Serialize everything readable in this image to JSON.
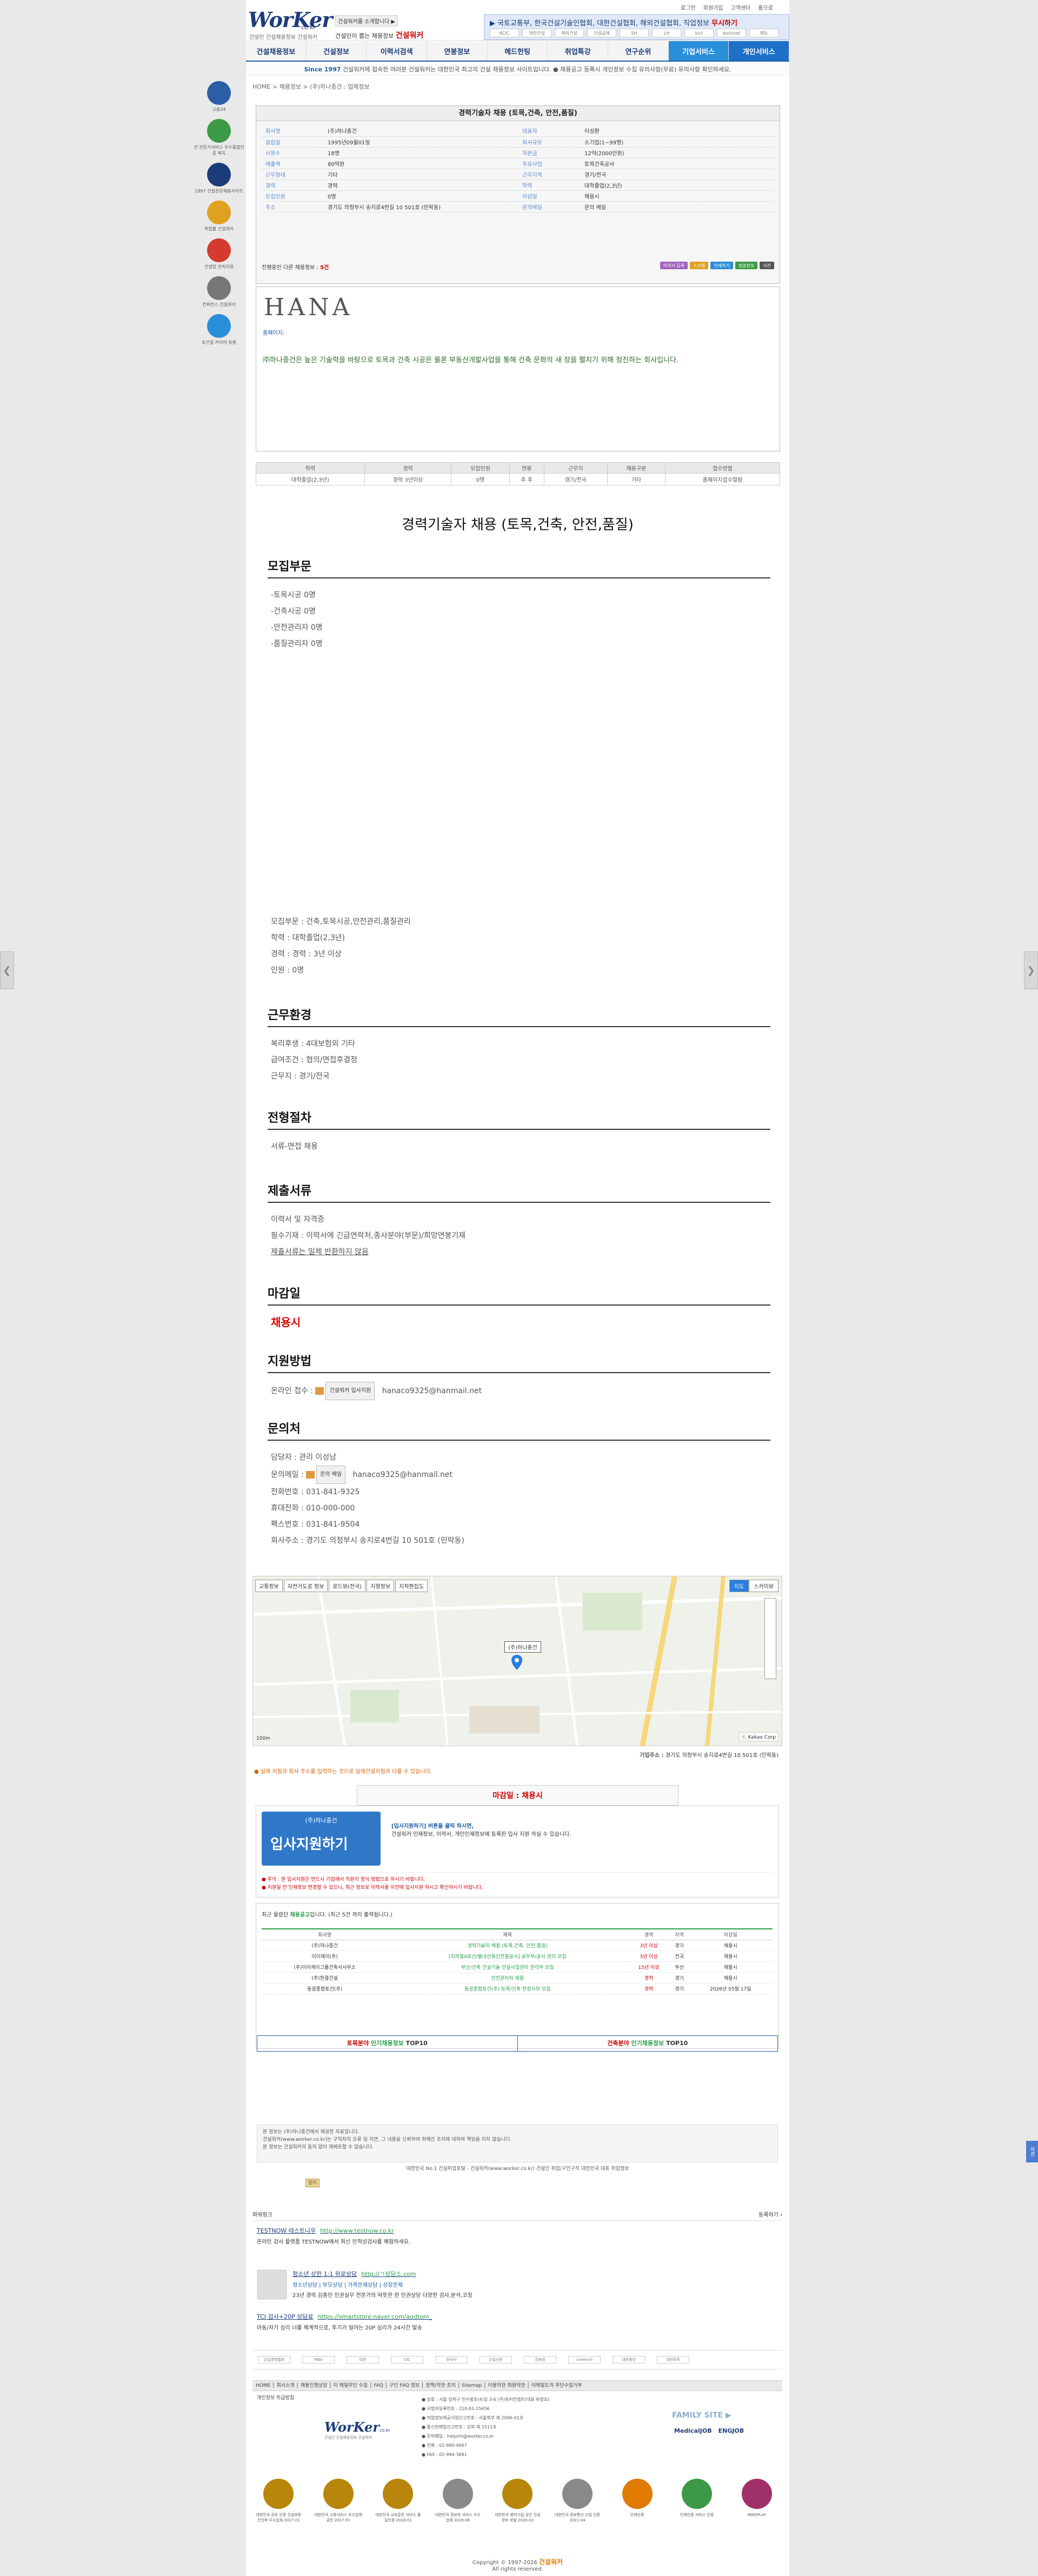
{
  "side": {
    "left_arrow": "❮",
    "right_arrow": "❯",
    "feedback": "의견"
  },
  "header": {
    "logo_text": "WorKer",
    "logo_domain": "co.kr",
    "logo_tagline": "건설인 건설채용정보 건설워커",
    "promo_badge": "건설워커를 소개합니다 ▶",
    "promo_line": "건설인이 뽑는 채용정보",
    "promo_brand": "건설워커",
    "top_links": [
      "로그인",
      "회원가입",
      "고객센터",
      "홈으로"
    ],
    "ticker_label": "▶ 국토교통부, 한국건설기술인협회, 대한건설협회, 해외건설협회, 직업정보 ",
    "ticker_accent": "무시하기",
    "ticker_logos": [
      "KCIC",
      "대한건설",
      "해외건설",
      "건설공제",
      "SH",
      "LH",
      "kict",
      "worknet",
      "에듀"
    ]
  },
  "nav": [
    "건설채용정보",
    "건설정보",
    "이력서검색",
    "연봉정보",
    "헤드헌팅",
    "취업특강",
    "연구순위",
    "기업서비스",
    "개인서비스"
  ],
  "notice": {
    "accent": "Since 1997",
    "text": " 건설워커에 접속한 여러분 건설워커는 대한민국 최고의 건설 채용정보 사이트입니다. ● 채용공고 등록시 개인정보 수집 유의사항(무료) 유의사항 확인하세요."
  },
  "breadcrumb": "HOME > 채용정보 > (주)하나종건 : 업체정보",
  "quick": [
    {
      "label": "고용24",
      "color": "#2b5ea7"
    },
    {
      "label": "건 전문가서비스 우수중합인증 획득",
      "color": "#3c9a46"
    },
    {
      "label": "1997 건설전문채용사이트",
      "color": "#1d3d7a"
    },
    {
      "label": "취업률 건설워커",
      "color": "#e0a020"
    },
    {
      "label": "건설업 전직지원",
      "color": "#d23b2e"
    },
    {
      "label": "컨퍼런스 건설워커",
      "color": "#777777"
    },
    {
      "label": "조건설 커리어 유형",
      "color": "#2a8fd9"
    }
  ],
  "summary": {
    "title": "경력기술자 채용 (토목,건축, 안전,품질)",
    "rows": [
      [
        {
          "k": "회사명",
          "v": "(주)하나종건"
        },
        {
          "k": "대표자",
          "v": "이성환"
        }
      ],
      [
        {
          "k": "설립일",
          "v": "1995년09월01일"
        },
        {
          "k": "회사규모",
          "v": "소기업(1~99명)"
        }
      ],
      [
        {
          "k": "사원수",
          "v": "18명"
        },
        {
          "k": "자본금",
          "v": "12억(2000만원)"
        }
      ],
      [
        {
          "k": "매출액",
          "v": "80억원"
        },
        {
          "k": "주요사업",
          "v": "토목건축공사"
        }
      ],
      [
        {
          "k": "근무형태",
          "v": "기타"
        },
        {
          "k": "근무지역",
          "v": "경기/전국"
        }
      ],
      [
        {
          "k": "경력",
          "v": "경력"
        },
        {
          "k": "학력",
          "v": "대학졸업(2,3년)"
        }
      ],
      [
        {
          "k": "모집인원",
          "v": "0명"
        },
        {
          "k": "마감일",
          "v": "채용시"
        }
      ],
      [
        {
          "k": "주소",
          "v": "경기도 의정부시 송지로4번길 10 501호 (민락동)"
        },
        {
          "k": "문의메일",
          "v": "문의 메일"
        }
      ]
    ],
    "foot_prefix": "진행중인 다른 채용정보 : ",
    "foot_count": "5건",
    "buttons": [
      "이력서 등록",
      "스크랩",
      "인쇄하기",
      "맞춤정보",
      "사진"
    ]
  },
  "company": {
    "logo_text": "HANA",
    "info": "홈페이지:",
    "desc": "㈜하나종건은 높은 기술력을 바탕으로 토목과 건축 시공은 물론 부동산개발사업을 통해 건축 문화의 새 장을 펼치기 위해 정진하는 회사입니다."
  },
  "mini": {
    "headers": [
      "학력",
      "경력",
      "모집인원",
      "연봉",
      "근무지",
      "채용구분",
      "접수방법"
    ],
    "values": [
      "대학졸업(2,3년)",
      "경력 3년이상",
      "0명",
      "추 후",
      "경기/전국",
      "기타",
      "홈페이지접수열람"
    ]
  },
  "main_title": "경력기술자 채용 (토목,건축, 안전,품질)",
  "sections": {
    "recruit": {
      "title": "모집부문",
      "lines": [
        "-토목시공 0명",
        "-건축시공 0명",
        "-안전관리자 0명",
        "-품질관리자 0명"
      ],
      "lines2": [
        "모집부문 : 건축,토목시공,안전관리,품질관리",
        "학력 : 대학졸업(2,3년)",
        "경력 : 경력 : 3년 이상",
        "인원 : 0명"
      ]
    },
    "work": {
      "title": "근무환경",
      "lines": [
        "복리후생 : 4대보험외 기타",
        "급여조건 : 협의/면접후결정",
        "근무지 : 경기/전국"
      ]
    },
    "process": {
      "title": "전형절차",
      "lines": [
        "서류-면접 채용"
      ]
    },
    "docs": {
      "title": "제출서류",
      "lines": [
        "이력서 및 자격증",
        "필수기재 : 이력서에 긴급연락처,종사분야(부문)/희망연봉기재"
      ],
      "link": "제출서류는 일체 반환하지 않음"
    },
    "deadline": {
      "title": "마감일",
      "value": "채용시"
    },
    "apply": {
      "title": "지원방법",
      "label": "온라인 접수 : ",
      "btn": "건설워커 입사지원",
      "email": "hanaco9325@hanmail.net"
    },
    "contact": {
      "title": "문의처",
      "lines": [
        "담당자 : 관리 이성남"
      ],
      "mail_label": "문의메일 : ",
      "mail_btn": "문의 메일",
      "mail": "hanaco9325@hanmail.net",
      "lines2": [
        "전화번호 : 031-841-9325",
        "휴대전화 : 010-000-000",
        "팩스번호 : 031-841-9504",
        "회사주소 : 경기도 의정부시 송지로4번길 10 501호 (민락동)"
      ]
    }
  },
  "map": {
    "tabs": [
      "교통정보",
      "자전거도로 정보",
      "로드뷰(전국)",
      "지형정보",
      "지적편집도"
    ],
    "modes": [
      "지도",
      "스카이뷰"
    ],
    "marker": "(주)하나종건",
    "scale": "100m",
    "copyright": "ⓒ Kakao Corp",
    "addr_label": "기업주소 : ",
    "addr": "경기도 의정부시 송지로4번길 10 501호 (민락동)",
    "warn": "● 실제 지점과 회사 주소를 입력하는 것으로 실제건설지점과 다를 수 있습니다."
  },
  "deadline_box": "마감일 : 채용시",
  "apply_box": {
    "company": "(주)하나종건",
    "btn": "입사지원하기",
    "txt1": "[입사지원하기] 버튼을 클릭 하시면,",
    "txt2": "건설워커 인재정보, 이력서, 개인인재정보에 등록된 입사 지원 하실 수 있습니다.",
    "warn1": "● 주의 : 본 입사지원은 반드시 기업에서 직원의 정식 방법으로 하시기 바랍니다.",
    "warn2": "● 지원일 전 인재정보 변경할 수 있으니, 최근 정보로 이력서를 이전에 입사지원 하시고 확인하시기 바랍니다."
  },
  "others": {
    "hd_prefix": "최근 올렸던 ",
    "hd_accent": "채용공고",
    "hd_suffix": "입니다. (최근 5건 까지 출력됩니다.)",
    "headers": [
      "회사명",
      "제목",
      "경력",
      "지역",
      "마감일"
    ],
    "rows": [
      [
        "(주)하나종건",
        "경력기술자 채용 (토목,건축, 안전,품질)",
        "3년 이상",
        "경기",
        "채용시"
      ],
      [
        "이이제이(주)",
        "[지하철8호선/별내선복선전철공사] 공무부/공사 관리 모집",
        "3년 이상",
        "전국",
        "채용시"
      ],
      [
        "(주)이이제이그룹건축사사무소",
        "부산/건축 건설기술 건설사업관리 관리부 모집",
        "15년 이상",
        "부산",
        "채용시"
      ],
      [
        "(주)한결건설",
        "안전관리자 채용",
        "경력",
        "경기",
        "채용시"
      ],
      [
        "동광종합토건(주)",
        "동광종합토건(주) 토목/건축 현장사무 모집",
        "경력",
        "경기",
        "2026년 05월 17일"
      ]
    ]
  },
  "top10": {
    "l_prefix": "토목분야 ",
    "l_accent": "인기채용정보",
    "l_suffix": " TOP10",
    "r_prefix": "건축분야 ",
    "r_accent": "인기채용정보",
    "r_suffix": " TOP10"
  },
  "disclaimer": {
    "lines": [
      "본 정보는 (주)하나종건에서 제공한 자료입니다.",
      "건설워커(www.worker.co.kr)는 구직자의 오류 및 지연, 그 내용을 신뢰하여 취해진 조치에 대하여 책임을 지지 않습니다.",
      "본 정보는 건설워커의 동의 없이 재배포할 수 없습니다."
    ],
    "line2": "대한민국 No.1 건설취업포털 - 건설워커(www.worker.co.kr) 건설인 취업/구인구직 대한민국 대표 취업정보",
    "close": "닫기"
  },
  "ads": {
    "hd": "파워링크",
    "hd_right": "등록하기 ›",
    "items": [
      {
        "title": "TESTNOW 테스트나우",
        "url": "http://www.testnow.co.kr",
        "desc": "온라인 검사 플랫폼 TESTNOW에서 최신 인적성검사를 체험하세요."
      },
      {
        "title": "청소년 상한 1:1 위로상담",
        "url": "http://ㄱ상담소.com",
        "desc": "청소년상담 | 부모상담 | 가족문제상담 | 성장문제",
        "desc2": "23년 경력 김종민 인권실무 전문가의 따뜻한 한 인권상담 다양한 검사,분석,코칭"
      },
      {
        "title": "TCI 검사+20P 상담료",
        "url": "https://smartstore.naver.com/aodtom_",
        "desc": "아동/자기 심리 너를 체계적으로, 투기가 일어는 20P 심리가 24시간 발송"
      }
    ]
  },
  "partners": [
    "건설경영협회",
    "MBA",
    "대한",
    "CIC",
    "한국사",
    "건설신문",
    "건축원",
    "coretech",
    "대한중앙",
    "대한토목"
  ],
  "footnav": "HOME │ 회사소개 │ 채용진행상담 │ 이 메일무단 수집 │ FAQ │ 구인 FAQ 정보 │ 정책/약관 조치 │ Sitemap │ 이용약관 회원약관 │ 이메일도의 무단수집거부",
  "privacy": "개인정보 취급방침",
  "footer": {
    "logo": "WorKer",
    "logo_domain": "co.kr",
    "tagline": "건설인 건설채용정보 건설워커",
    "info": [
      "● 상호 : 서울 강북구 인수봉로(4)길 3-6 (주)워커컨셉트(대표 유영호)",
      "● 사업자등록번호 : 210-81-25656",
      "● 직업정보제공사업신고번호 : 서울북부 제 2006-01호",
      "● 통신판매업신고번호 : 강북 제 1511호",
      "● 문의메일 : helpmh@worker.co.kr",
      "● 전화 : 02-990-4697",
      "● FAX : 02-994-3691"
    ],
    "family_title": "FAMILY SITE ▶",
    "family_links": [
      "MedicalJOB",
      "ENGJOB"
    ]
  },
  "badges": [
    {
      "t": "대한민국 공로 인증 건설부동산인력 우수업체 2017-01"
    },
    {
      "t": "대한민국 고용서비스 우수업체 공인 2017-01"
    },
    {
      "t": "대한민국 교육훈련 서비스 품질인증 2018-01"
    },
    {
      "t": "대한민국 정보화 서비스 우수업체 2019-06"
    },
    {
      "t": "대한민국 벤처기업 공인 건설정보 포털 2020-03"
    },
    {
      "t": "대한민국 정보통신 산업 인증 2021-04"
    },
    {
      "t": "인재인증"
    },
    {
      "t": "인재인증 서비스 인증"
    },
    {
      "t": "INNOPLAY"
    }
  ],
  "copyright": {
    "prefix": "Copyright © 1997-2026 ",
    "brand": "건설워커",
    "suffix": "All rights reserved."
  }
}
